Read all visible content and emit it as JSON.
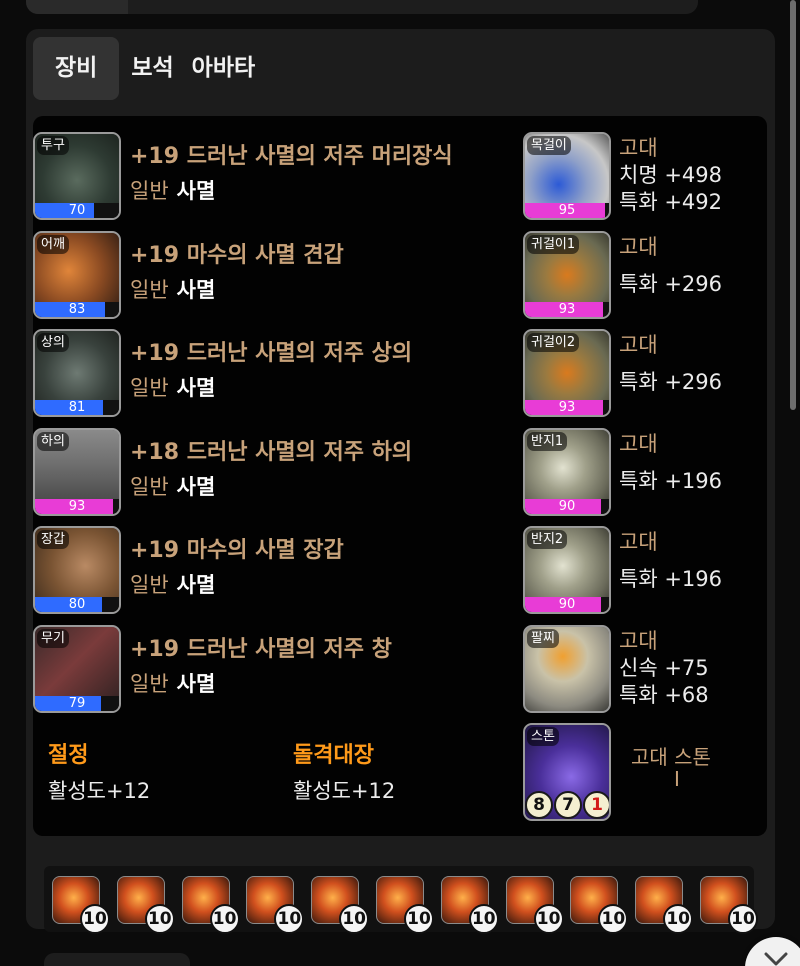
{
  "tabs": [
    "장비",
    "보석",
    "아바타"
  ],
  "gear": [
    {
      "slot": "투구",
      "quality": 70,
      "quality_color": "#2f6bff",
      "name": "+19 드러난 사멸의 저주 머리장식",
      "tier": "일반",
      "set": "사멸",
      "icon": "helmet-icon"
    },
    {
      "slot": "어깨",
      "quality": 83,
      "quality_color": "#2f6bff",
      "name": "+19 마수의 사멸 견갑",
      "tier": "일반",
      "set": "사멸",
      "icon": "shoulder-icon"
    },
    {
      "slot": "상의",
      "quality": 81,
      "quality_color": "#2f6bff",
      "name": "+19 드러난 사멸의 저주 상의",
      "tier": "일반",
      "set": "사멸",
      "icon": "chest-armor-icon"
    },
    {
      "slot": "하의",
      "quality": 93,
      "quality_color": "#e83cd6",
      "name": "+18 드러난 사멸의 저주 하의",
      "tier": "일반",
      "set": "사멸",
      "icon": "pants-icon"
    },
    {
      "slot": "장갑",
      "quality": 80,
      "quality_color": "#2f6bff",
      "name": "+19 마수의 사멸 장갑",
      "tier": "일반",
      "set": "사멸",
      "icon": "gloves-icon"
    },
    {
      "slot": "무기",
      "quality": 79,
      "quality_color": "#2f6bff",
      "name": "+19 드러난 사멸의 저주 창",
      "tier": "일반",
      "set": "사멸",
      "icon": "spear-icon"
    }
  ],
  "accessories": [
    {
      "slot": "목걸이",
      "quality": 95,
      "quality_color": "#e83cd6",
      "grade": "고대",
      "stats": [
        "치명 +498",
        "특화 +492"
      ],
      "icon": "necklace-icon"
    },
    {
      "slot": "귀걸이1",
      "quality": 93,
      "quality_color": "#e83cd6",
      "grade": "고대",
      "stats": [
        "특화 +296"
      ],
      "icon": "earring-icon"
    },
    {
      "slot": "귀걸이2",
      "quality": 93,
      "quality_color": "#e83cd6",
      "grade": "고대",
      "stats": [
        "특화 +296"
      ],
      "icon": "earring-icon"
    },
    {
      "slot": "반지1",
      "quality": 90,
      "quality_color": "#e83cd6",
      "grade": "고대",
      "stats": [
        "특화 +196"
      ],
      "icon": "ring-icon"
    },
    {
      "slot": "반지2",
      "quality": 90,
      "quality_color": "#e83cd6",
      "grade": "고대",
      "stats": [
        "특화 +196"
      ],
      "icon": "ring-icon"
    },
    {
      "slot": "팔찌",
      "grade": "고대",
      "stats": [
        "신속 +75",
        "특화 +68"
      ],
      "icon": "bracelet-icon"
    }
  ],
  "stone": {
    "slot": "스톤",
    "label": "고대 스톤",
    "sub": "I",
    "levels": [
      "8",
      "7",
      "1"
    ],
    "icon": "ability-stone-icon"
  },
  "engravings": [
    {
      "name": "절정",
      "value": "활성도+12"
    },
    {
      "name": "돌격대장",
      "value": "활성도+12"
    }
  ],
  "gems": {
    "count": 11,
    "level": "10",
    "icon": "gem-icon"
  },
  "colors": {
    "accent_gold": "#c8a27a",
    "engrave_orange": "#ff9a1a",
    "quality_blue": "#2f6bff",
    "quality_pink": "#e83cd6"
  }
}
